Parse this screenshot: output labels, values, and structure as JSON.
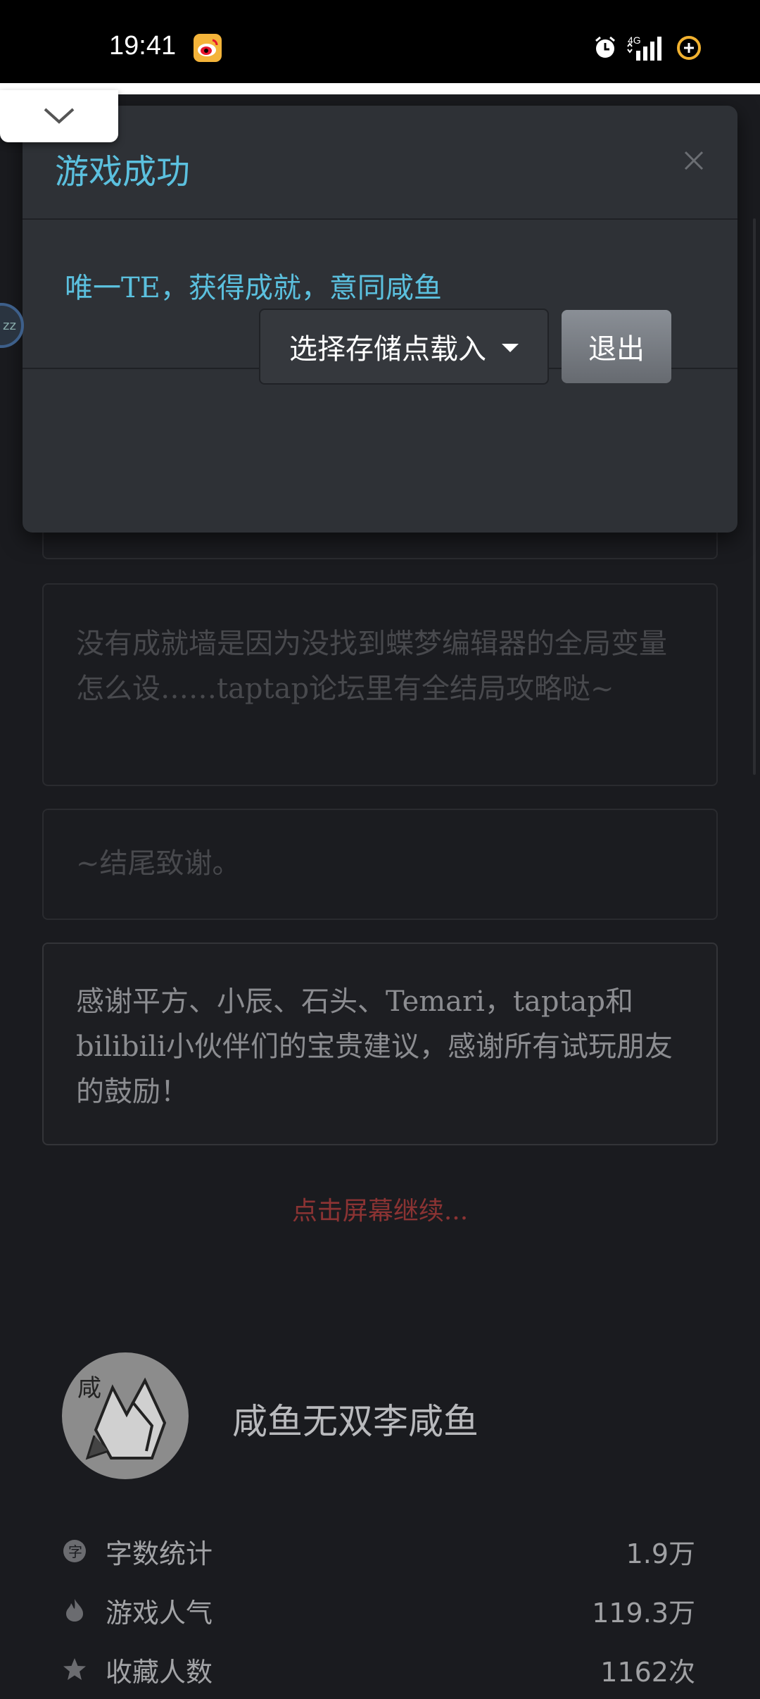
{
  "status_bar": {
    "time": "19:41",
    "network": "4G",
    "icons": [
      "weibo-icon",
      "alarm-icon",
      "signal-icon",
      "battery-saver-icon"
    ]
  },
  "modal": {
    "title": "游戏成功",
    "message": "唯一TE，获得成就，意同咸鱼",
    "load_button_label": "选择存储点载入",
    "exit_button_label": "退出",
    "accent_color": "#5bc0de"
  },
  "story": {
    "cards": [
      {
        "text": "没有成就墙是因为没找到蝶梦编辑器的全局变量怎么设……taptap论坛里有全结局攻略哒~"
      },
      {
        "text": "~结尾致谢。"
      },
      {
        "text": "感谢平方、小辰、石头、Temari，taptap和bilibili小伙伴们的宝贵建议，感谢所有试玩朋友的鼓励！"
      }
    ],
    "continue_hint": "点击屏幕继续..."
  },
  "author": {
    "avatar_char": "咸",
    "name": "咸鱼无双李咸鱼"
  },
  "stats": [
    {
      "icon": "word-count-icon",
      "label": "字数统计",
      "value": "1.9万"
    },
    {
      "icon": "fire-icon",
      "label": "游戏人气",
      "value": "119.3万"
    },
    {
      "icon": "star-icon",
      "label": "收藏人数",
      "value": "1162次"
    }
  ]
}
